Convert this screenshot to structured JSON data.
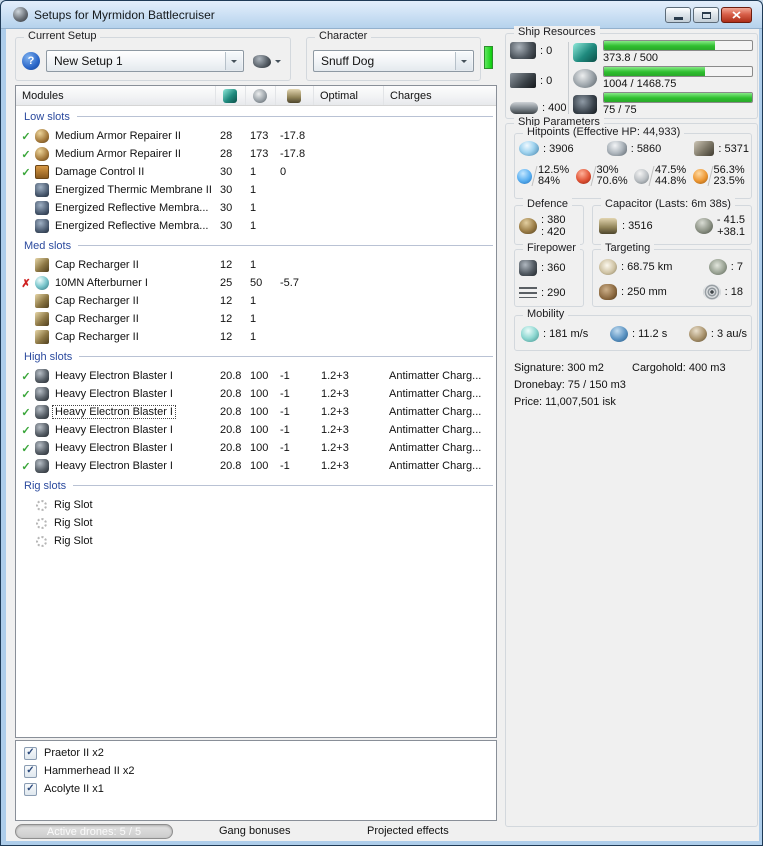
{
  "window": {
    "title": "Setups for Myrmidon Battlecruiser"
  },
  "setup": {
    "current_setup_label": "Current Setup",
    "setup_value": "New Setup 1",
    "character_label": "Character",
    "character_value": "Snuff Dog"
  },
  "modules_table": {
    "header": {
      "modules": "Modules",
      "optimal": "Optimal",
      "charges": "Charges"
    },
    "sections": [
      {
        "title": "Low slots",
        "rows": [
          {
            "status": "ok",
            "icon": "armor-repairer",
            "name": "Medium Armor Repairer II",
            "cpu": "28",
            "pg": "173",
            "cap": "-17.8",
            "optimal": "",
            "charges": ""
          },
          {
            "status": "ok",
            "icon": "armor-repairer",
            "name": "Medium Armor Repairer II",
            "cpu": "28",
            "pg": "173",
            "cap": "-17.8",
            "optimal": "",
            "charges": ""
          },
          {
            "status": "ok",
            "icon": "damage-control",
            "name": "Damage Control II",
            "cpu": "30",
            "pg": "1",
            "cap": "0",
            "optimal": "",
            "charges": ""
          },
          {
            "status": "none",
            "icon": "membrane",
            "name": "Energized Thermic Membrane II",
            "cpu": "30",
            "pg": "1",
            "cap": "",
            "optimal": "",
            "charges": ""
          },
          {
            "status": "none",
            "icon": "membrane",
            "name": "Energized Reflective Membra...",
            "cpu": "30",
            "pg": "1",
            "cap": "",
            "optimal": "",
            "charges": ""
          },
          {
            "status": "none",
            "icon": "membrane",
            "name": "Energized Reflective Membra...",
            "cpu": "30",
            "pg": "1",
            "cap": "",
            "optimal": "",
            "charges": ""
          }
        ]
      },
      {
        "title": "Med slots",
        "rows": [
          {
            "status": "none",
            "icon": "cap-recharger",
            "name": "Cap Recharger II",
            "cpu": "12",
            "pg": "1",
            "cap": "",
            "optimal": "",
            "charges": ""
          },
          {
            "status": "error",
            "icon": "afterburner",
            "name": "10MN Afterburner I",
            "cpu": "25",
            "pg": "50",
            "cap": "-5.7",
            "optimal": "",
            "charges": ""
          },
          {
            "status": "none",
            "icon": "cap-recharger",
            "name": "Cap Recharger II",
            "cpu": "12",
            "pg": "1",
            "cap": "",
            "optimal": "",
            "charges": ""
          },
          {
            "status": "none",
            "icon": "cap-recharger",
            "name": "Cap Recharger II",
            "cpu": "12",
            "pg": "1",
            "cap": "",
            "optimal": "",
            "charges": ""
          },
          {
            "status": "none",
            "icon": "cap-recharger",
            "name": "Cap Recharger II",
            "cpu": "12",
            "pg": "1",
            "cap": "",
            "optimal": "",
            "charges": ""
          }
        ]
      },
      {
        "title": "High slots",
        "rows": [
          {
            "status": "ok",
            "icon": "blaster",
            "name": "Heavy Electron Blaster I",
            "cpu": "20.8",
            "pg": "100",
            "cap": "-1",
            "optimal": "1.2+3",
            "charges": "Antimatter Charg..."
          },
          {
            "status": "ok",
            "icon": "blaster",
            "name": "Heavy Electron Blaster I",
            "cpu": "20.8",
            "pg": "100",
            "cap": "-1",
            "optimal": "1.2+3",
            "charges": "Antimatter Charg..."
          },
          {
            "status": "ok",
            "icon": "blaster",
            "name": "Heavy Electron Blaster I",
            "cpu": "20.8",
            "pg": "100",
            "cap": "-1",
            "optimal": "1.2+3",
            "charges": "Antimatter Charg...",
            "focused": true
          },
          {
            "status": "ok",
            "icon": "blaster",
            "name": "Heavy Electron Blaster I",
            "cpu": "20.8",
            "pg": "100",
            "cap": "-1",
            "optimal": "1.2+3",
            "charges": "Antimatter Charg..."
          },
          {
            "status": "ok",
            "icon": "blaster",
            "name": "Heavy Electron Blaster I",
            "cpu": "20.8",
            "pg": "100",
            "cap": "-1",
            "optimal": "1.2+3",
            "charges": "Antimatter Charg..."
          },
          {
            "status": "ok",
            "icon": "blaster",
            "name": "Heavy Electron Blaster I",
            "cpu": "20.8",
            "pg": "100",
            "cap": "-1",
            "optimal": "1.2+3",
            "charges": "Antimatter Charg..."
          }
        ]
      },
      {
        "title": "Rig slots",
        "rows": [
          {
            "status": "none",
            "icon": "rig-slot",
            "name": "Rig Slot",
            "cpu": "",
            "pg": "",
            "cap": "",
            "optimal": "",
            "charges": ""
          },
          {
            "status": "none",
            "icon": "rig-slot",
            "name": "Rig Slot",
            "cpu": "",
            "pg": "",
            "cap": "",
            "optimal": "",
            "charges": ""
          },
          {
            "status": "none",
            "icon": "rig-slot",
            "name": "Rig Slot",
            "cpu": "",
            "pg": "",
            "cap": "",
            "optimal": "",
            "charges": ""
          }
        ]
      }
    ]
  },
  "drones": {
    "items": [
      {
        "checked": true,
        "label": "Praetor II x2"
      },
      {
        "checked": true,
        "label": "Hammerhead II x2"
      },
      {
        "checked": true,
        "label": "Acolyte II x1"
      }
    ]
  },
  "footer": {
    "active_drones": "Active drones: 5 / 5",
    "gang_bonuses": "Gang bonuses",
    "projected_effects": "Projected effects"
  },
  "ship_resources": {
    "title": "Ship Resources",
    "turrets": ": 0",
    "launchers": ": 0",
    "calibration": ": 400",
    "bars": [
      {
        "icon": "cpu",
        "label": "373.8 / 500",
        "used": 373.8,
        "total": 500
      },
      {
        "icon": "powergrid",
        "label": "1004 / 1468.75",
        "used": 1004,
        "total": 1468.75
      },
      {
        "icon": "drones",
        "label": "75 / 75",
        "used": 75,
        "total": 75
      }
    ]
  },
  "ship_parameters": {
    "title": "Ship Parameters",
    "hitpoints": {
      "title": "Hitpoints (Effective HP: 44,933)",
      "shield": ": 3906",
      "armor": ": 5860",
      "structure": ": 5371",
      "resists": [
        {
          "icon": "em",
          "line1": "12.5%",
          "line2": "84%"
        },
        {
          "icon": "thermal",
          "line1": "30%",
          "line2": "70.6%"
        },
        {
          "icon": "kinetic",
          "line1": "47.5%",
          "line2": "44.8%"
        },
        {
          "icon": "explosive",
          "line1": "56.3%",
          "line2": "23.5%"
        }
      ]
    },
    "defence": {
      "title": "Defence",
      "repair1": ": 380",
      "repair2": ": 420"
    },
    "capacitor": {
      "title": "Capacitor (Lasts: 6m 38s)",
      "amount": ": 3516",
      "drain": "- 41.5",
      "recharge": "+38.1"
    },
    "firepower": {
      "title": "Firepower",
      "dps": ": 360",
      "volley": ": 290"
    },
    "targeting": {
      "title": "Targeting",
      "range": ": 68.75 km",
      "max_targets": ": 7",
      "scan_resolution": ": 250 mm",
      "sensor_strength": ": 18"
    },
    "mobility": {
      "title": "Mobility",
      "speed": ": 181 m/s",
      "align_time": ": 11.2 s",
      "warp_speed": ": 3 au/s"
    },
    "signature": "Signature: 300 m2",
    "cargohold": "Cargohold: 400 m3",
    "dronebay": "Dronebay: 75 / 150 m3",
    "price": "Price: 11,007,501 isk"
  },
  "colors": {
    "progress_green": "#2fbf2f",
    "status_ok_green": "#3aa63a",
    "status_error_red": "#cf2020",
    "character_status_green": "#1ed11e",
    "section_header_blue": "#2b4a9e",
    "titlebar_blue": "#cfe2f5"
  },
  "icon_names": {
    "cpu": "teal-chip",
    "powergrid": "atom",
    "capacitor": "battery",
    "turret-hardpoints": "turret",
    "launcher-hardpoints": "launcher-box",
    "calibration": "tool",
    "drones": "drone-cluster",
    "shield": "blue-dome",
    "armor": "plate",
    "structure": "cube",
    "em": "blue-lightning",
    "thermal": "red-flame",
    "kinetic": "gray-shard",
    "explosive": "orange-burst",
    "defence": "bronze-shield",
    "cap-delta": "engine",
    "turret": "gun",
    "volley": "dashes",
    "radar": "dish",
    "scan-res": "insect",
    "max-targets": "compass",
    "sensor": "target-rings",
    "speed": "teal-rock",
    "align": "blue-anchor",
    "warp": "snail",
    "status-ok": "green-check",
    "status-error": "red-cross",
    "rig-slot": "dotted-circle"
  }
}
